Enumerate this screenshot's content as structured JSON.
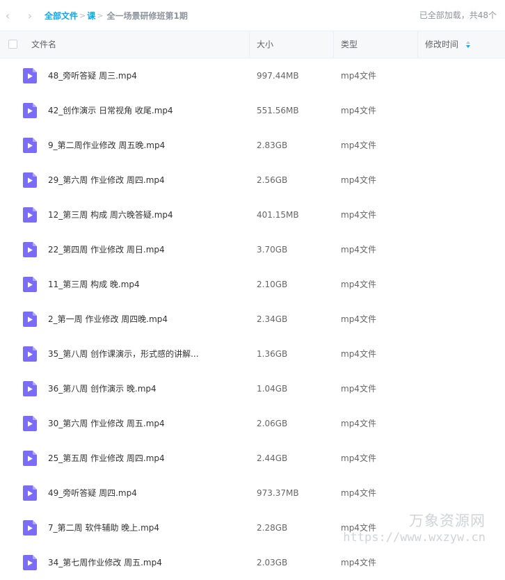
{
  "nav": {
    "back_glyph": "‹",
    "forward_glyph": "›"
  },
  "breadcrumb": {
    "root": "全部文件",
    "sep": ">",
    "folder": "课",
    "current": "全一场景研修班第1期"
  },
  "status": "已全部加载，共48个",
  "columns": {
    "name": "文件名",
    "size": "大小",
    "type": "类型",
    "modified": "修改时间"
  },
  "files": [
    {
      "name": "48_旁听答疑 周三.mp4",
      "size": "997.44MB",
      "type": "mp4文件"
    },
    {
      "name": "42_创作演示 日常视角 收尾.mp4",
      "size": "551.56MB",
      "type": "mp4文件"
    },
    {
      "name": "9_第二周作业修改 周五晚.mp4",
      "size": "2.83GB",
      "type": "mp4文件"
    },
    {
      "name": "29_第六周 作业修改 周四.mp4",
      "size": "2.56GB",
      "type": "mp4文件"
    },
    {
      "name": "12_第三周 构成 周六晚答疑.mp4",
      "size": "401.15MB",
      "type": "mp4文件"
    },
    {
      "name": "22_第四周 作业修改 周日.mp4",
      "size": "3.70GB",
      "type": "mp4文件"
    },
    {
      "name": "11_第三周 构成 晚.mp4",
      "size": "2.10GB",
      "type": "mp4文件"
    },
    {
      "name": "2_第一周 作业修改 周四晚.mp4",
      "size": "2.34GB",
      "type": "mp4文件"
    },
    {
      "name": "35_第八周 创作课演示，形式感的讲解...",
      "size": "1.36GB",
      "type": "mp4文件"
    },
    {
      "name": "36_第八周 创作演示 晚.mp4",
      "size": "1.04GB",
      "type": "mp4文件"
    },
    {
      "name": "30_第六周 作业修改 周五.mp4",
      "size": "2.06GB",
      "type": "mp4文件"
    },
    {
      "name": "25_第五周 作业修改 周四.mp4",
      "size": "2.44GB",
      "type": "mp4文件"
    },
    {
      "name": "49_旁听答疑 周四.mp4",
      "size": "973.37MB",
      "type": "mp4文件"
    },
    {
      "name": "7_第二周 软件辅助 晚上.mp4",
      "size": "2.28GB",
      "type": "mp4文件"
    },
    {
      "name": "34_第七周作业修改 周五.mp4",
      "size": "2.03GB",
      "type": "mp4文件"
    }
  ],
  "watermark": {
    "title": "万象资源网",
    "url": "https://www.wxzyw.cn"
  },
  "colors": {
    "accent": "#06a7ff",
    "file_icon": "#7b6cf6",
    "header_bg": "#f7f8fa"
  },
  "icons": {
    "file": "video-file-icon",
    "sort": "sort-icon"
  }
}
